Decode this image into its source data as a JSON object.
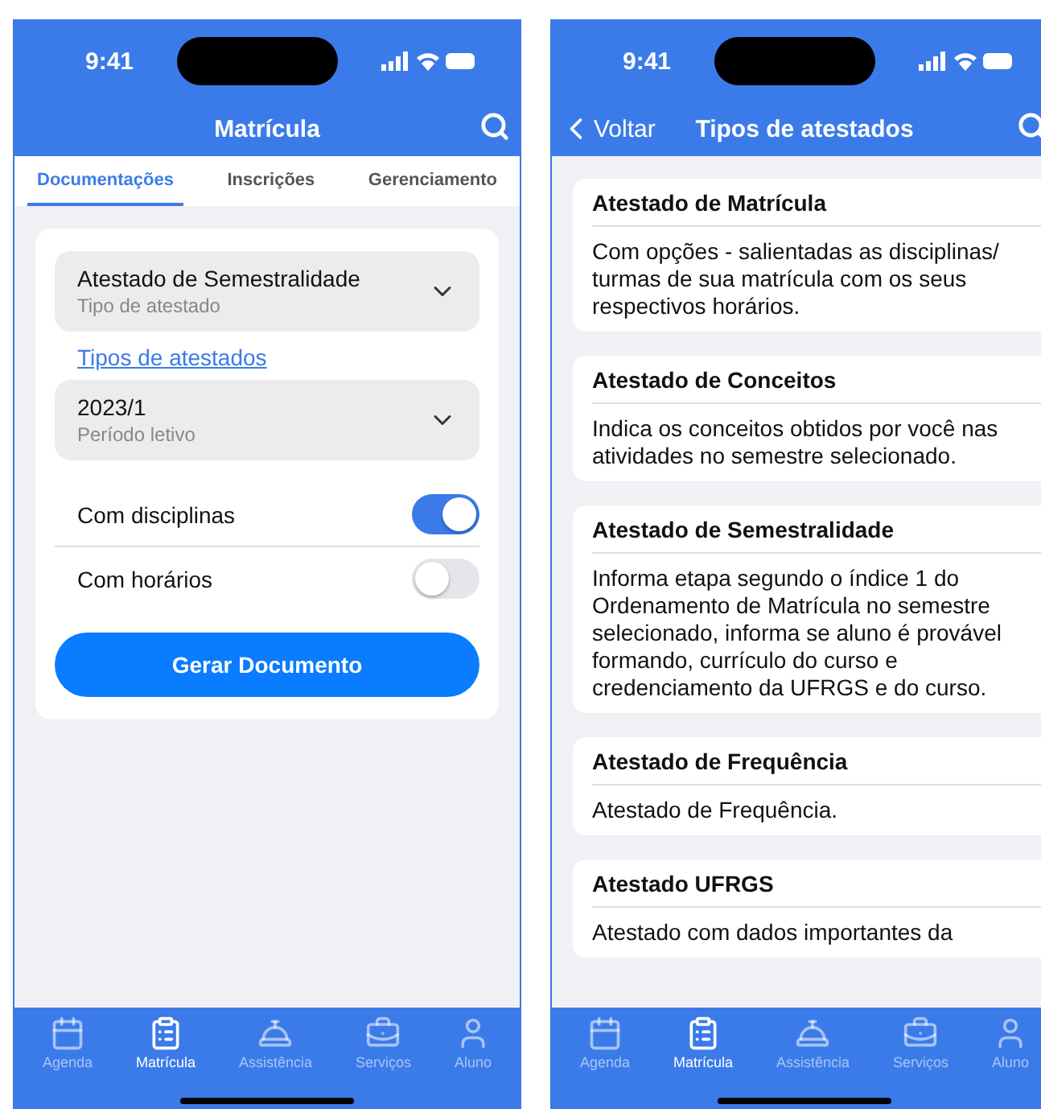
{
  "screens": [
    {
      "kind": "form",
      "status_time": "9:41",
      "nav": {
        "title": "Matrícula"
      },
      "tabs": [
        {
          "label": "Documentações",
          "selected": true
        },
        {
          "label": "Inscrições",
          "selected": false
        },
        {
          "label": "Gerenciamento",
          "selected": false
        }
      ],
      "form": {
        "selects": [
          {
            "value": "Atestado de Semestralidade",
            "label": "Tipo de atestado"
          },
          {
            "value": "2023/1",
            "label": "Período letivo"
          }
        ],
        "link": "Tipos de atestados",
        "toggles": [
          {
            "label": "Com disciplinas",
            "on": true
          },
          {
            "label": "Com horários",
            "on": false
          }
        ],
        "button": "Gerar Documento"
      },
      "tab_bar": [
        {
          "label": "Agenda",
          "selected": false
        },
        {
          "label": "Matrícula",
          "selected": true
        },
        {
          "label": "Assistência",
          "selected": false
        },
        {
          "label": "Serviços",
          "selected": false
        },
        {
          "label": "Aluno",
          "selected": false
        }
      ]
    },
    {
      "kind": "list",
      "status_time": "9:41",
      "nav": {
        "back": "Voltar",
        "title": "Tipos de atestados"
      },
      "cards": [
        {
          "title": "Atestado de Matrícula",
          "text": "Com opções - salientadas as disciplinas/ turmas de sua matrícula com os seus respectivos horários."
        },
        {
          "title": "Atestado de Conceitos",
          "text": "Indica os conceitos obtidos por você nas atividades no semestre selecionado."
        },
        {
          "title": "Atestado de Semestralidade",
          "text": "Informa etapa segundo o índice 1 do Ordenamento de Matrícula no semestre selecionado, informa se aluno é provável formando, currículo do curso e credenciamento da UFRGS e do curso."
        },
        {
          "title": "Atestado de Frequência",
          "text": "Atestado de Frequência."
        },
        {
          "title": "Atestado UFRGS",
          "text": "Atestado com dados importantes da"
        }
      ],
      "tab_bar": [
        {
          "label": "Agenda",
          "selected": false
        },
        {
          "label": "Matrícula",
          "selected": true
        },
        {
          "label": "Assistência",
          "selected": false
        },
        {
          "label": "Serviços",
          "selected": false
        },
        {
          "label": "Aluno",
          "selected": false
        }
      ]
    }
  ]
}
